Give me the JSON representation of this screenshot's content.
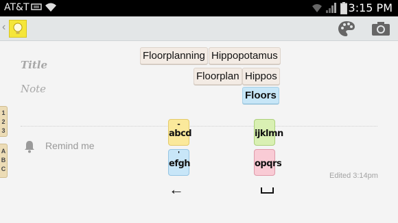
{
  "status_bar": {
    "carrier": "AT&T",
    "time": "3:15 PM",
    "icons": [
      "usb-icon",
      "wifi-icon",
      "wifi-signal-icon",
      "cell-signal-icon",
      "battery-icon"
    ]
  },
  "action_bar": {
    "icons": [
      "back-chevron-icon",
      "app-icon-lightbulb",
      "palette-icon",
      "camera-icon"
    ],
    "back_glyph": "‹"
  },
  "note": {
    "title_placeholder": "Title",
    "note_placeholder": "Note",
    "remind_label": "Remind me",
    "edited": "Edited 3:14pm"
  },
  "side_tabs": {
    "numbers": [
      "1",
      "2",
      "3"
    ],
    "letters": [
      "A",
      "B",
      "C"
    ]
  },
  "suggestions": {
    "row1": [
      "Floorplanning",
      "Hippopotamus"
    ],
    "row2": [
      "Floorplan",
      "Hippos"
    ],
    "selected": "Floors"
  },
  "keyboard": {
    "keys": [
      {
        "top": "-",
        "main": "abcd",
        "color": "#fbe99b"
      },
      {
        "top": "",
        "main": "ijklmn",
        "color": "#d9f0b3"
      },
      {
        "top": "'",
        "main": "efgh",
        "color": "#c8e6f8"
      },
      {
        "top": "",
        "main": "opqrs",
        "color": "#f9cbd5"
      }
    ],
    "backspace_glyph": "←",
    "space_icon": "space-icon"
  }
}
